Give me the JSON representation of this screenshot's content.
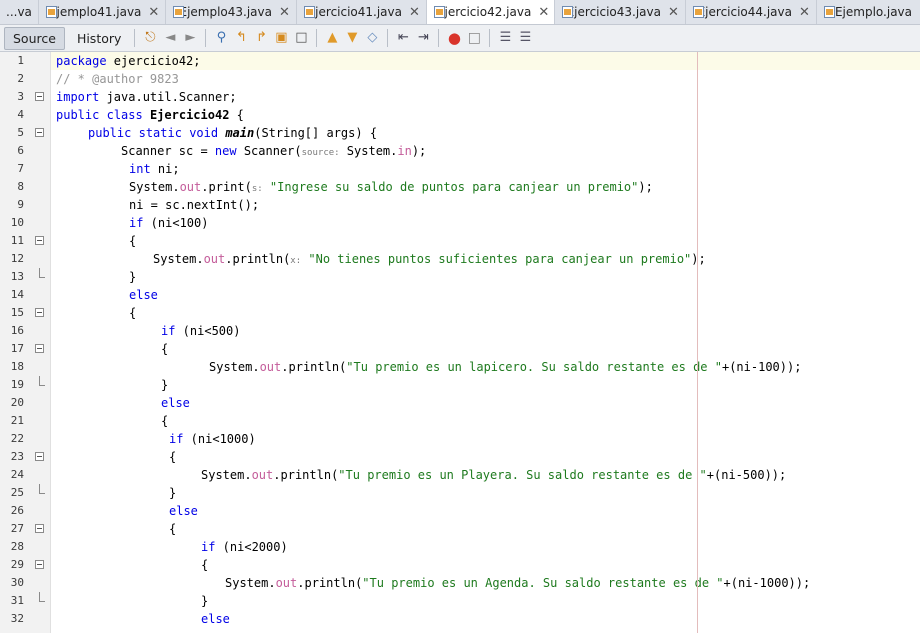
{
  "tabs": [
    {
      "label": "...va",
      "active": false,
      "has_icon": false
    },
    {
      "label": "Ejemplo41.java",
      "active": false,
      "has_icon": true
    },
    {
      "label": "Ejemplo43.java",
      "active": false,
      "has_icon": true
    },
    {
      "label": "Ejercicio41.java",
      "active": false,
      "has_icon": true
    },
    {
      "label": "Ejercicio42.java",
      "active": true,
      "has_icon": true
    },
    {
      "label": "Ejercicio43.java",
      "active": false,
      "has_icon": true
    },
    {
      "label": "Ejercicio44.java",
      "active": false,
      "has_icon": true
    },
    {
      "label": "Ejemplo.java",
      "active": false,
      "has_icon": true
    }
  ],
  "toolbar": {
    "source_label": "Source",
    "history_label": "History",
    "icons": [
      "last-edit-icon",
      "back-icon",
      "forward-icon",
      "find-icon",
      "find-previous-icon",
      "find-next-icon",
      "find-selection-icon",
      "toggle-highlight-icon",
      "previous-bookmark-icon",
      "next-bookmark-icon",
      "toggle-bookmark-icon",
      "shift-left-icon",
      "shift-right-icon",
      "start-macro-icon",
      "stop-macro-icon",
      "comment-icon",
      "uncomment-icon"
    ]
  },
  "editor": {
    "lines": [
      {
        "n": "1",
        "t": "package ejercicio42;"
      },
      {
        "n": "2",
        "t": "// * @author 9823"
      },
      {
        "n": "3",
        "t": "import java.util.Scanner;"
      },
      {
        "n": "4",
        "t": "public class Ejercicio42 {"
      },
      {
        "n": "5",
        "t": "public static void main(String[] args) {"
      },
      {
        "n": "6",
        "t": "Scanner sc = new Scanner(source: System.in);"
      },
      {
        "n": "7",
        "t": "int ni;"
      },
      {
        "n": "8",
        "t": "System.out.print(s: \"Ingrese su saldo de puntos para canjear un premio\");"
      },
      {
        "n": "9",
        "t": "ni = sc.nextInt();"
      },
      {
        "n": "10",
        "t": "if (ni<100)"
      },
      {
        "n": "11",
        "t": "{"
      },
      {
        "n": "12",
        "t": "System.out.println(x: \"No tienes puntos suficientes para canjear un premio\");"
      },
      {
        "n": "13",
        "t": "}"
      },
      {
        "n": "14",
        "t": "else"
      },
      {
        "n": "15",
        "t": "{"
      },
      {
        "n": "16",
        "t": "if (ni<500)"
      },
      {
        "n": "17",
        "t": "{"
      },
      {
        "n": "18",
        "t": "System.out.println(\"Tu premio es un lapicero. Su saldo restante es de \"+(ni-100));"
      },
      {
        "n": "19",
        "t": "}"
      },
      {
        "n": "20",
        "t": "else"
      },
      {
        "n": "21",
        "t": "{"
      },
      {
        "n": "22",
        "t": "if (ni<1000)"
      },
      {
        "n": "23",
        "t": "{"
      },
      {
        "n": "24",
        "t": "System.out.println(\"Tu premio es un Playera. Su saldo restante es de \"+(ni-500));"
      },
      {
        "n": "25",
        "t": "}"
      },
      {
        "n": "26",
        "t": "else"
      },
      {
        "n": "27",
        "t": "{"
      },
      {
        "n": "28",
        "t": "if (ni<2000)"
      },
      {
        "n": "29",
        "t": "{"
      },
      {
        "n": "30",
        "t": "System.out.println(\"Tu premio es un Agenda. Su saldo restante es de \"+(ni-1000));"
      },
      {
        "n": "31",
        "t": "}"
      },
      {
        "n": "32",
        "t": "else"
      }
    ]
  },
  "colors": {
    "keyword": "#0000e6",
    "string": "#1e7a1e",
    "comment": "#969696",
    "field": "#c45c9a",
    "current_line": "#fcfbe8"
  }
}
